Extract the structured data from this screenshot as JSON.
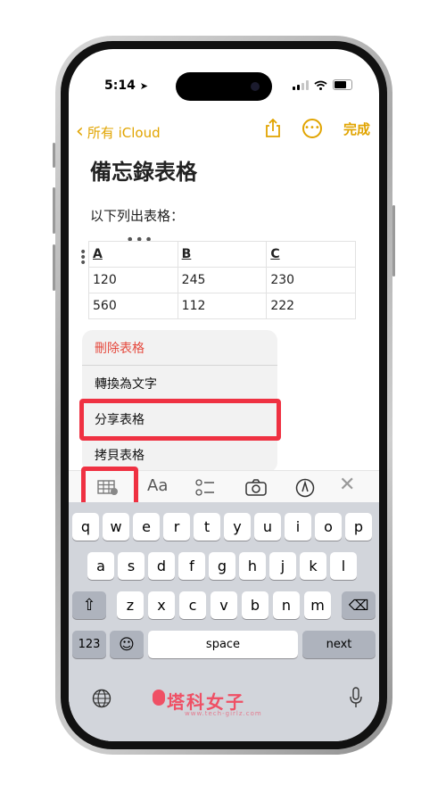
{
  "status": {
    "time": "5:14"
  },
  "nav": {
    "back_label": "所有 iCloud",
    "done_label": "完成"
  },
  "note": {
    "title": "備忘錄表格",
    "subtitle": "以下列出表格："
  },
  "table": {
    "headers": [
      "A",
      "B",
      "C"
    ],
    "rows": [
      [
        "120",
        "245",
        "230"
      ],
      [
        "560",
        "112",
        "222"
      ]
    ]
  },
  "menu": {
    "items": [
      {
        "label": "刪除表格"
      },
      {
        "label": "轉換為文字"
      },
      {
        "label": "分享表格"
      },
      {
        "label": "拷貝表格"
      }
    ]
  },
  "keyboard": {
    "row1": [
      "q",
      "w",
      "e",
      "r",
      "t",
      "y",
      "u",
      "i",
      "o",
      "p"
    ],
    "row2": [
      "a",
      "s",
      "d",
      "f",
      "g",
      "h",
      "j",
      "k",
      "l"
    ],
    "row3": [
      "z",
      "x",
      "c",
      "v",
      "b",
      "n",
      "m"
    ],
    "numbers_label": "123",
    "space_label": "space",
    "next_label": "next"
  },
  "watermark": {
    "brand": "塔科女子",
    "url": "www.tech-girlz.com"
  },
  "colors": {
    "accent": "#e1a400",
    "danger": "#e5483c",
    "highlight": "#ef3142"
  },
  "icons": [
    "location-arrow-icon",
    "signal-icon",
    "wifi-icon",
    "battery-icon",
    "chevron-left-icon",
    "share-icon",
    "more-icon",
    "table-icon",
    "text-format-icon",
    "checklist-icon",
    "camera-icon",
    "markup-pen-icon",
    "close-icon",
    "shift-icon",
    "delete-icon",
    "emoji-icon",
    "globe-icon",
    "microphone-icon"
  ]
}
